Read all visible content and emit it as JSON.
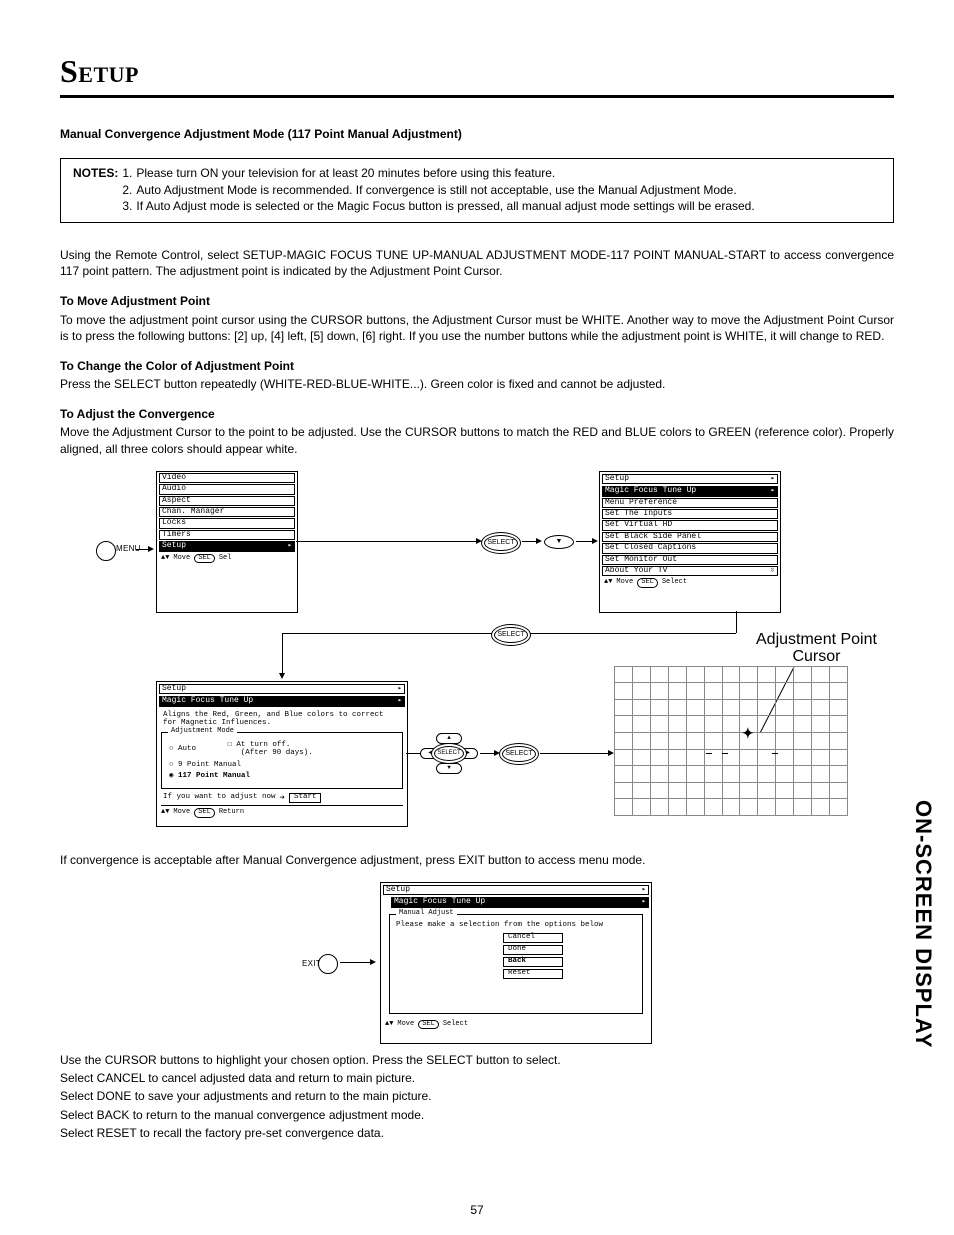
{
  "section_title": "Setup",
  "subheading": "Manual Convergence Adjustment Mode (117 Point Manual Adjustment)",
  "notes_label": "NOTES:",
  "notes": [
    {
      "n": "1.",
      "t": "Please turn ON your television for at least 20 minutes before using this feature."
    },
    {
      "n": "2.",
      "t": "Auto Adjustment Mode is recommended.  If convergence is still not acceptable, use the Manual Adjustment Mode."
    },
    {
      "n": "3.",
      "t": "If Auto Adjust mode is selected or the Magic Focus button is pressed, all manual adjust mode settings will be erased."
    }
  ],
  "para_intro": "Using the Remote Control, select SETUP-MAGIC FOCUS TUNE UP-MANUAL ADJUSTMENT MODE-117 POINT MANUAL-START to access convergence 117 point pattern.  The adjustment point is indicated by the Adjustment Point Cursor.",
  "h_move": "To Move Adjustment Point",
  "para_move": "To move the adjustment point cursor using the CURSOR buttons, the Adjustment Cursor must be WHITE.  Another way to move the Adjustment Point Cursor is to press the following buttons:  [2] up, [4] left, [5] down, [6] right.  If you use the number buttons while the adjustment point is WHITE, it will change to RED.",
  "h_color": "To Change the Color of Adjustment Point",
  "para_color": "Press the SELECT button repeatedly (WHITE-RED-BLUE-WHITE...).  Green color is fixed and cannot be adjusted.",
  "h_adj": "To Adjust the Convergence",
  "para_adj": "Move the Adjustment Cursor to the point to be adjusted.  Use the CURSOR buttons to match the RED and BLUE colors to GREEN (reference color).  Properly aligned, all three colors should appear white.",
  "menu_label": "MENU",
  "exit_label": "EXIT",
  "select_label": "SELECT",
  "sel_abbr": "SEL",
  "osd1": {
    "items": [
      "Video",
      "Audio",
      "Aspect",
      "Chan. Manager",
      "Locks",
      "Timers",
      "Setup"
    ],
    "selected": 6,
    "foot_move": "Move",
    "foot_sel": "Sel"
  },
  "osd2": {
    "title": "Setup",
    "items": [
      "Magic Focus Tune Up",
      "Menu Preference",
      "Set The Inputs",
      "Set Virtual HD",
      "Set Black Side Panel",
      "Set Closed Captions",
      "Set Monitor Out",
      "About Your TV"
    ],
    "selected": 0,
    "foot_move": "Move",
    "foot_sel": "Select"
  },
  "osd3": {
    "title": "Setup",
    "subtitle": "Magic Focus Tune Up",
    "desc": "Aligns the Red, Green, and Blue colors to correct for Magnetic Influences.",
    "group_label": "Adjustment Mode",
    "opt_auto": "Auto",
    "chk_label": "At turn off.",
    "chk_sub": "(After 90 days).",
    "opt_9": "9 Point Manual",
    "opt_117": "117 Point Manual",
    "prompt": "If you want to adjust now",
    "start_btn": "Start",
    "foot_move": "Move",
    "foot_ret": "Return"
  },
  "osd4": {
    "title": "Setup",
    "subtitle": "Magic Focus Tune Up",
    "group_label": "Manual Adjust",
    "instr": "Please make a selection from the options below",
    "options": [
      "Cancel",
      "Done",
      "Back",
      "Reset"
    ],
    "selected": 2,
    "foot_move": "Move",
    "foot_sel": "Select"
  },
  "ap_label_line1": "Adjustment Point",
  "ap_label_line2": "Cursor",
  "para_after_grid": "If convergence is acceptable after Manual Convergence adjustment, press EXIT button to access menu mode.",
  "tail": [
    "Use the CURSOR buttons to highlight your chosen option.  Press the SELECT button to select.",
    "Select CANCEL to cancel adjusted data and return to main picture.",
    "Select DONE to save your adjustments and return to the main picture.",
    "Select BACK to return to the manual convergence adjustment mode.",
    "Select RESET to recall the factory pre-set convergence data."
  ],
  "side_label": "ON-SCREEN DISPLAY",
  "page_number": "57"
}
